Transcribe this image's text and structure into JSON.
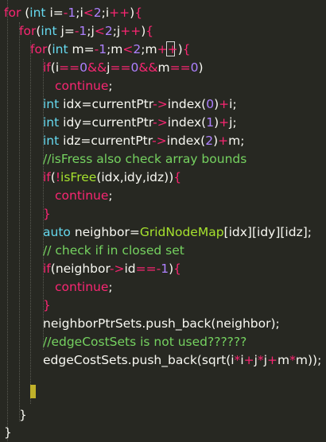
{
  "editor": {
    "lines": [
      [
        {
          "c": "k",
          "t": "for"
        },
        {
          "c": "v",
          "t": " ("
        },
        {
          "c": "t",
          "t": "int"
        },
        {
          "c": "v",
          "t": " i="
        },
        {
          "c": "k",
          "t": "-"
        },
        {
          "c": "n",
          "t": "1"
        },
        {
          "c": "v",
          "t": ";i"
        },
        {
          "c": "k",
          "t": "<"
        },
        {
          "c": "n",
          "t": "2"
        },
        {
          "c": "v",
          "t": ";i"
        },
        {
          "c": "k",
          "t": "++"
        },
        {
          "c": "v",
          "t": ")"
        },
        {
          "c": "p",
          "t": "{"
        }
      ],
      [
        {
          "c": "k",
          "t": "for"
        },
        {
          "c": "v",
          "t": "("
        },
        {
          "c": "t",
          "t": "int"
        },
        {
          "c": "v",
          "t": " j="
        },
        {
          "c": "k",
          "t": "-"
        },
        {
          "c": "n",
          "t": "1"
        },
        {
          "c": "v",
          "t": ";j"
        },
        {
          "c": "k",
          "t": "<"
        },
        {
          "c": "n",
          "t": "2"
        },
        {
          "c": "v",
          "t": ";j"
        },
        {
          "c": "k",
          "t": "++"
        },
        {
          "c": "v",
          "t": ")"
        },
        {
          "c": "p",
          "t": "{"
        }
      ],
      [
        {
          "c": "k",
          "t": "for"
        },
        {
          "c": "v",
          "t": "("
        },
        {
          "c": "t",
          "t": "int"
        },
        {
          "c": "v",
          "t": " m="
        },
        {
          "c": "k",
          "t": "-"
        },
        {
          "c": "n",
          "t": "1"
        },
        {
          "c": "v",
          "t": ";m"
        },
        {
          "c": "k",
          "t": "<"
        },
        {
          "c": "n",
          "t": "2"
        },
        {
          "c": "v",
          "t": ";m"
        },
        {
          "c": "k",
          "t": "++"
        },
        {
          "c": "v",
          "t": ")"
        },
        {
          "c": "p",
          "t": "{"
        }
      ],
      [
        {
          "c": "k",
          "t": "if"
        },
        {
          "c": "v",
          "t": "(i"
        },
        {
          "c": "k",
          "t": "=="
        },
        {
          "c": "n",
          "t": "0"
        },
        {
          "c": "k",
          "t": "&&"
        },
        {
          "c": "v",
          "t": "j"
        },
        {
          "c": "k",
          "t": "=="
        },
        {
          "c": "n",
          "t": "0"
        },
        {
          "c": "k",
          "t": "&&"
        },
        {
          "c": "v",
          "t": "m"
        },
        {
          "c": "k",
          "t": "=="
        },
        {
          "c": "n",
          "t": "0"
        },
        {
          "c": "v",
          "t": ")"
        }
      ],
      [
        {
          "c": "k",
          "t": "continue"
        },
        {
          "c": "v",
          "t": ";"
        }
      ],
      [
        {
          "c": "t",
          "t": "int"
        },
        {
          "c": "v",
          "t": " idx=currentPtr"
        },
        {
          "c": "k",
          "t": "->"
        },
        {
          "c": "v",
          "t": "index("
        },
        {
          "c": "n",
          "t": "0"
        },
        {
          "c": "v",
          "t": ")"
        },
        {
          "c": "k",
          "t": "+"
        },
        {
          "c": "v",
          "t": "i;"
        }
      ],
      [
        {
          "c": "t",
          "t": "int"
        },
        {
          "c": "v",
          "t": " idy=currentPtr"
        },
        {
          "c": "k",
          "t": "->"
        },
        {
          "c": "v",
          "t": "index("
        },
        {
          "c": "n",
          "t": "1"
        },
        {
          "c": "v",
          "t": ")"
        },
        {
          "c": "k",
          "t": "+"
        },
        {
          "c": "v",
          "t": "j;"
        }
      ],
      [
        {
          "c": "t",
          "t": "int"
        },
        {
          "c": "v",
          "t": " idz=currentPtr"
        },
        {
          "c": "k",
          "t": "->"
        },
        {
          "c": "v",
          "t": "index("
        },
        {
          "c": "n",
          "t": "2"
        },
        {
          "c": "v",
          "t": ")"
        },
        {
          "c": "k",
          "t": "+"
        },
        {
          "c": "v",
          "t": "m;"
        }
      ],
      [
        {
          "c": "c",
          "t": "//isFress also check array bounds"
        }
      ],
      [
        {
          "c": "k",
          "t": "if"
        },
        {
          "c": "v",
          "t": "("
        },
        {
          "c": "k",
          "t": "!"
        },
        {
          "c": "f",
          "t": "isFree"
        },
        {
          "c": "v",
          "t": "(idx,idy,idz))"
        },
        {
          "c": "p",
          "t": "{"
        }
      ],
      [
        {
          "c": "k",
          "t": "continue"
        },
        {
          "c": "v",
          "t": ";"
        }
      ],
      [
        {
          "c": "p",
          "t": "}"
        }
      ],
      [
        {
          "c": "t",
          "t": "auto"
        },
        {
          "c": "v",
          "t": " neighbor="
        },
        {
          "c": "f",
          "t": "GridNodeMap"
        },
        {
          "c": "v",
          "t": "[idx][idy][idz];"
        }
      ],
      [
        {
          "c": "c",
          "t": "// check if in closed set"
        }
      ],
      [
        {
          "c": "k",
          "t": "if"
        },
        {
          "c": "v",
          "t": "(neighbor"
        },
        {
          "c": "k",
          "t": "->"
        },
        {
          "c": "v",
          "t": "id"
        },
        {
          "c": "k",
          "t": "=="
        },
        {
          "c": "k",
          "t": "-"
        },
        {
          "c": "n",
          "t": "1"
        },
        {
          "c": "v",
          "t": ")"
        },
        {
          "c": "p",
          "t": "{"
        }
      ],
      [
        {
          "c": "k",
          "t": "continue"
        },
        {
          "c": "v",
          "t": ";"
        }
      ],
      [
        {
          "c": "p",
          "t": "}"
        }
      ],
      [
        {
          "c": "v",
          "t": "neighborPtrSets.push_back(neighbor);"
        }
      ],
      [
        {
          "c": "c",
          "t": "//edgeCostSets is not used??????"
        }
      ],
      [
        {
          "c": "v",
          "t": "edgeCostSets.push_back(sqrt(i"
        },
        {
          "c": "k",
          "t": "*"
        },
        {
          "c": "v",
          "t": "i"
        },
        {
          "c": "k",
          "t": "+"
        },
        {
          "c": "v",
          "t": "j"
        },
        {
          "c": "k",
          "t": "*"
        },
        {
          "c": "v",
          "t": "j"
        },
        {
          "c": "k",
          "t": "+"
        },
        {
          "c": "v",
          "t": "m"
        },
        {
          "c": "k",
          "t": "*"
        },
        {
          "c": "v",
          "t": "m));"
        }
      ],
      [],
      [],
      [
        {
          "c": "v",
          "t": "}"
        }
      ],
      [
        {
          "c": "v",
          "t": "}"
        }
      ]
    ]
  }
}
